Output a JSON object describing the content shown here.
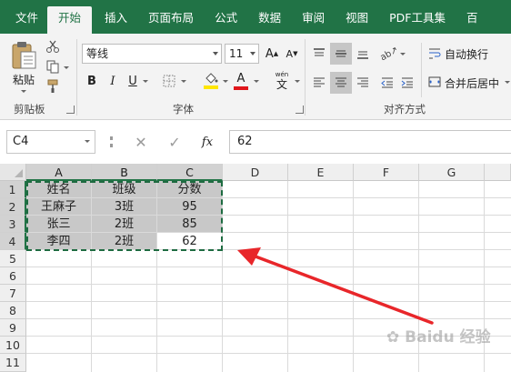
{
  "tabs": [
    {
      "label": "文件"
    },
    {
      "label": "开始",
      "active": true
    },
    {
      "label": "插入"
    },
    {
      "label": "页面布局"
    },
    {
      "label": "公式"
    },
    {
      "label": "数据"
    },
    {
      "label": "审阅"
    },
    {
      "label": "视图"
    },
    {
      "label": "PDF工具集"
    },
    {
      "label": "百"
    }
  ],
  "ribbon": {
    "clipboard": {
      "paste_label": "粘贴",
      "group_label": "剪贴板"
    },
    "font": {
      "font_name": "等线",
      "font_size": "11",
      "group_label": "字体",
      "phonetic_label": "wén"
    },
    "alignment": {
      "wrap_text_label": "自动换行",
      "merge_center_label": "合并后居中",
      "group_label": "对齐方式"
    }
  },
  "formula_bar": {
    "name_box": "C4",
    "fx_label": "fx",
    "formula_value": "62"
  },
  "columns": [
    "A",
    "B",
    "C",
    "D",
    "E",
    "F",
    "G"
  ],
  "rows": [
    "1",
    "2",
    "3",
    "4",
    "5",
    "6",
    "7",
    "8",
    "9",
    "10",
    "11"
  ],
  "table": [
    [
      "姓名",
      "班级",
      "分数"
    ],
    [
      "王麻子",
      "3班",
      "95"
    ],
    [
      "张三",
      "2班",
      "85"
    ],
    [
      "李四",
      "2班",
      "62"
    ]
  ],
  "watermark": "Baidu 经验",
  "colors": {
    "accent": "#217346",
    "selection_fill": "#c8c8c8",
    "arrow": "#e8262a"
  }
}
